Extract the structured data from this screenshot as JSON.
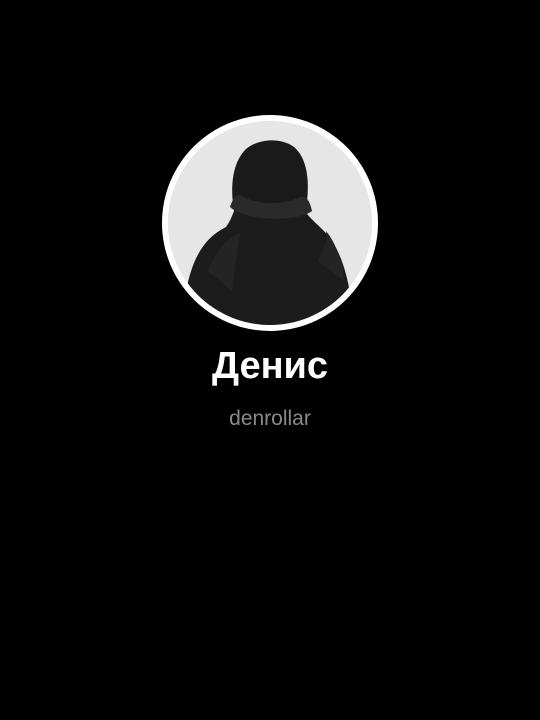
{
  "profile": {
    "display_name": "Денис",
    "username": "denrollar",
    "avatar": {
      "icon": "hooded-figure-silhouette",
      "background_color": "#e4e4e4",
      "figure_color": "#1c1c1c",
      "ring_color": "#ffffff"
    }
  },
  "colors": {
    "page_background": "#000000",
    "name_text": "#ffffff",
    "username_text": "#8a8a8a"
  }
}
